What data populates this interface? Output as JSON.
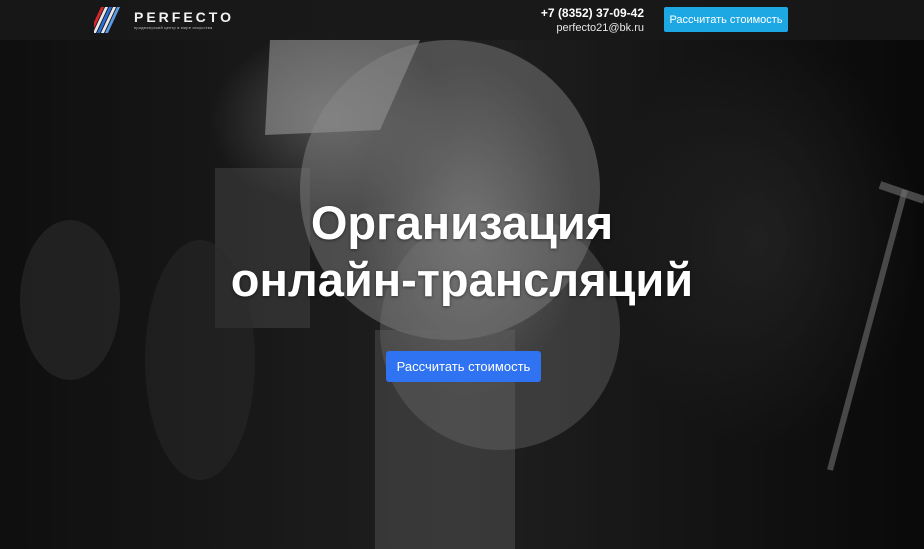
{
  "header": {
    "logo": {
      "name": "PERFECTO",
      "tagline": "продюсерский центр в мире искусства",
      "icon": "perfecto-stripes-logo"
    },
    "phone": "+7 (8352) 37-09-42",
    "email": "perfecto21@bk.ru",
    "cta_label": "Рассчитать стоимость"
  },
  "hero": {
    "title_line1": "Организация",
    "title_line2": "онлайн-трансляций",
    "cta_label": "Рассчитать стоимость",
    "background": "grayscale-photo-curly-hair-model"
  },
  "colors": {
    "header_button": "#1ea8e3",
    "hero_button": "#2f73f2",
    "logo_red": "#d8262a",
    "logo_blue": "#2b6fd6"
  }
}
